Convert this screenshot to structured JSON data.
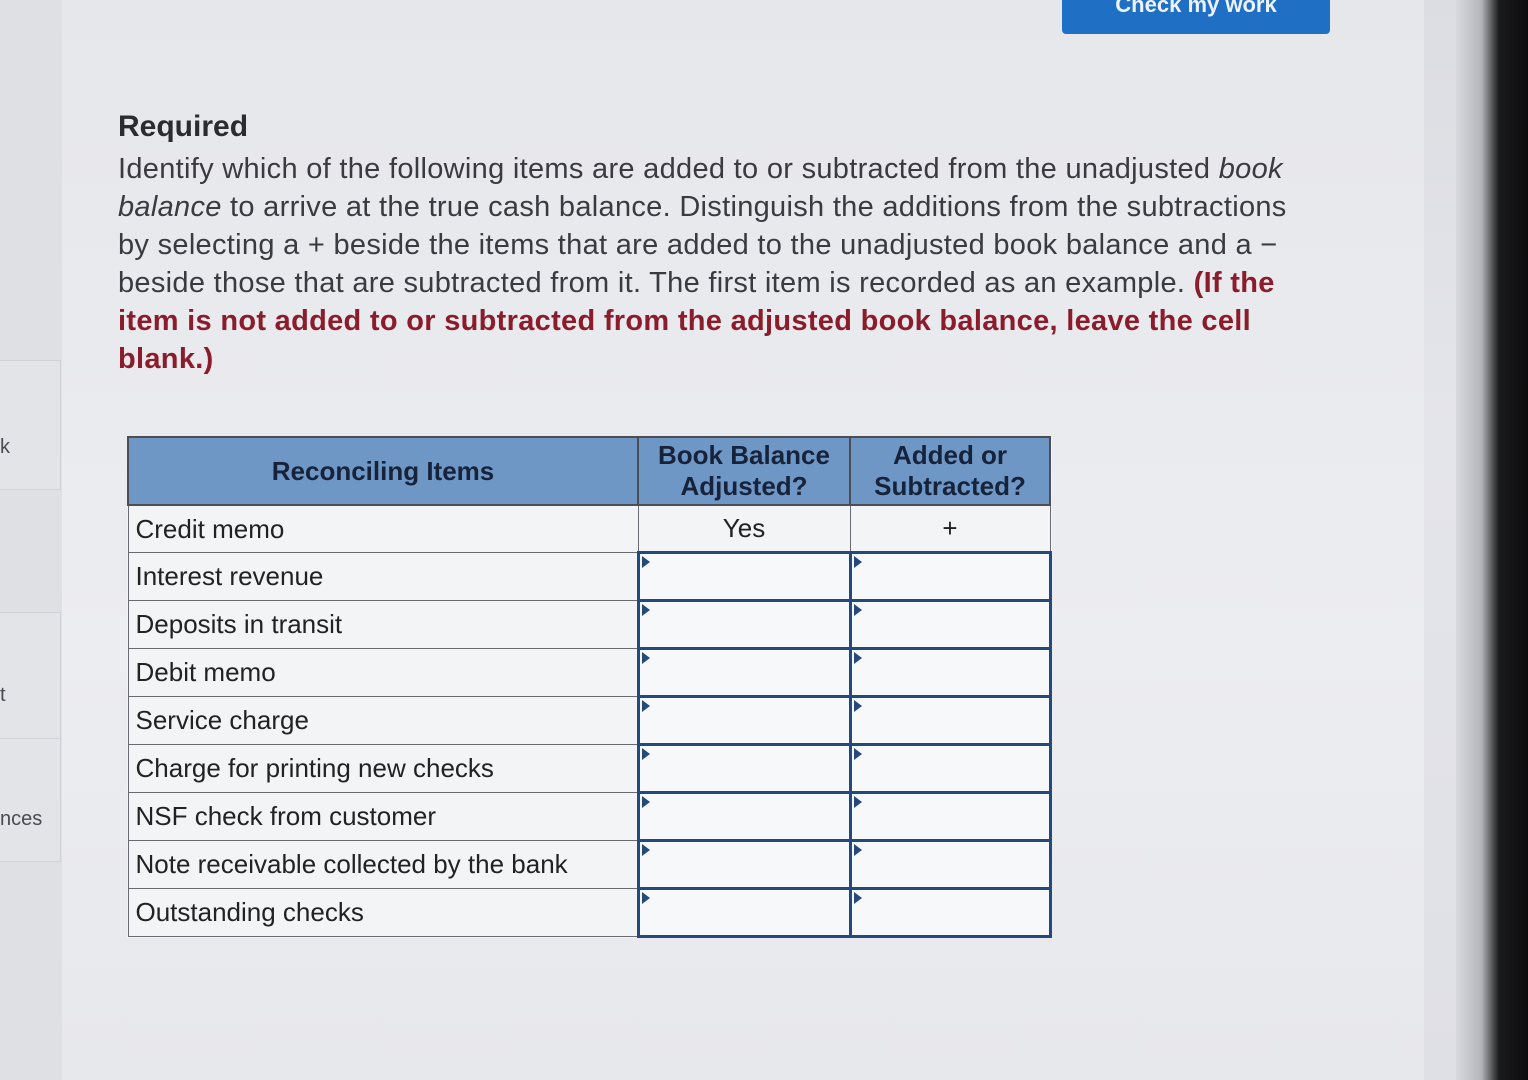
{
  "header": {
    "check_button_label": "Check my work"
  },
  "sidebar": {
    "fragments": [
      "k",
      "t",
      "nces"
    ]
  },
  "content": {
    "required_title": "Required",
    "instructions_part1": "Identify which of the following items are added to or subtracted from the unadjusted ",
    "instructions_emphasis": "book balance",
    "instructions_part2": " to arrive at the true cash balance. Distinguish the additions from the subtractions by selecting a + beside the items that are added to the unadjusted book balance and a − beside those that are subtracted from it. The first item is recorded as an example. ",
    "instructions_note": "(If the item is not added to or subtracted from the adjusted book balance, leave the cell blank.)"
  },
  "table": {
    "headers": {
      "items": "Reconciling Items",
      "adjusted": "Book Balance Adjusted?",
      "sign": "Added or Subtracted?"
    },
    "rows": [
      {
        "item": "Credit memo",
        "adjusted": "Yes",
        "sign": "+"
      },
      {
        "item": "Interest revenue",
        "adjusted": "",
        "sign": ""
      },
      {
        "item": "Deposits in transit",
        "adjusted": "",
        "sign": ""
      },
      {
        "item": "Debit memo",
        "adjusted": "",
        "sign": ""
      },
      {
        "item": "Service charge",
        "adjusted": "",
        "sign": ""
      },
      {
        "item": "Charge for printing new checks",
        "adjusted": "",
        "sign": ""
      },
      {
        "item": "NSF check from customer",
        "adjusted": "",
        "sign": ""
      },
      {
        "item": "Note receivable collected by the bank",
        "adjusted": "",
        "sign": ""
      },
      {
        "item": "Outstanding checks",
        "adjusted": "",
        "sign": ""
      }
    ]
  }
}
